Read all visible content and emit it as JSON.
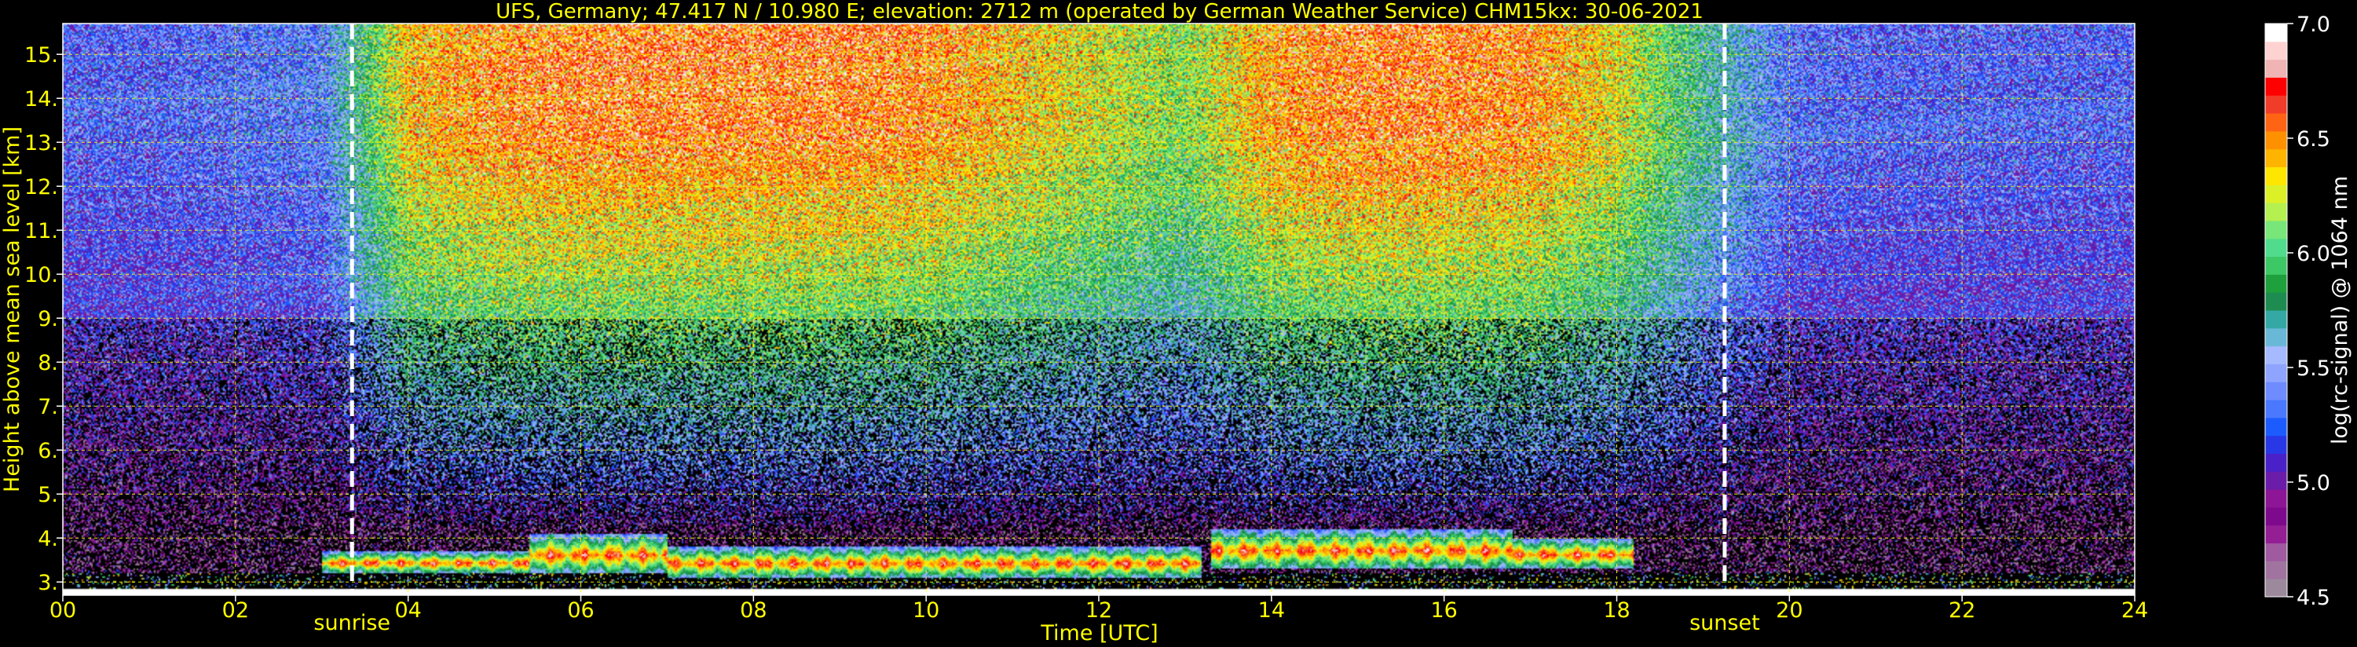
{
  "chart_data": {
    "type": "heatmap",
    "title": "UFS, Germany; 47.417 N / 10.980 E; elevation: 2712 m  (operated by German Weather Service)    CHM15kx: 30-06-2021",
    "xlabel": "Time [UTC]",
    "ylabel": "Height above mean sea level [km]",
    "xlim": [
      0,
      24
    ],
    "ylim": [
      2.7,
      15.7
    ],
    "xticks": [
      "00",
      "02",
      "04",
      "06",
      "08",
      "10",
      "12",
      "14",
      "16",
      "18",
      "20",
      "22",
      "24"
    ],
    "xtick_values": [
      0,
      2,
      4,
      6,
      8,
      10,
      12,
      14,
      16,
      18,
      20,
      22,
      24
    ],
    "yticks": [
      "3.",
      "4.",
      "5.",
      "6.",
      "7.",
      "8.",
      "9.",
      "10.",
      "11.",
      "12.",
      "13.",
      "14.",
      "15."
    ],
    "ytick_values": [
      3,
      4,
      5,
      6,
      7,
      8,
      9,
      10,
      11,
      12,
      13,
      14,
      15
    ],
    "grid": true,
    "annotations": [
      {
        "label": "sunrise",
        "x": 3.35
      },
      {
        "label": "sunset",
        "x": 19.25
      }
    ],
    "colorbar": {
      "label": "log(rc-signal) @ 1064 nm",
      "range": [
        4.5,
        7.0
      ],
      "ticks": [
        "4.5",
        "5.0",
        "5.5",
        "6.0",
        "6.5",
        "7.0"
      ],
      "tick_values": [
        4.5,
        5.0,
        5.5,
        6.0,
        6.5,
        7.0
      ],
      "colors": [
        "#9c8a9c",
        "#a0749f",
        "#a05aa0",
        "#941e94",
        "#7d0a8c",
        "#8c1696",
        "#6b1ca8",
        "#4a20c8",
        "#2838e6",
        "#1c5cff",
        "#4a78ff",
        "#6e8cff",
        "#8ea4ff",
        "#a6baff",
        "#6ab8d8",
        "#34a8a4",
        "#1e8c50",
        "#1ea03c",
        "#3cc864",
        "#50dc8c",
        "#78e678",
        "#b4f050",
        "#dcf028",
        "#ffe600",
        "#ffb400",
        "#ff9000",
        "#ff6414",
        "#f03c28",
        "#ff0000",
        "#f0b4b4",
        "#ffd2d2",
        "#ffffff"
      ]
    },
    "time_of_day_intensity": {
      "hours": [
        0,
        1,
        2,
        3,
        4,
        5,
        6,
        7,
        8,
        9,
        10,
        11,
        12,
        13,
        14,
        15,
        16,
        17,
        18,
        19,
        20,
        21,
        22,
        23,
        24
      ],
      "upper_signal": [
        5.3,
        5.3,
        5.35,
        5.4,
        6.4,
        6.55,
        6.6,
        6.6,
        6.6,
        6.6,
        6.55,
        6.4,
        6.25,
        6.1,
        6.5,
        6.6,
        6.6,
        6.55,
        6.3,
        5.8,
        5.35,
        5.3,
        5.3,
        5.3,
        5.3
      ]
    },
    "cloud_layers": [
      {
        "x_start": 3.0,
        "x_end": 5.4,
        "height_base": 3.2,
        "height_top": 3.7
      },
      {
        "x_start": 5.4,
        "x_end": 7.0,
        "height_base": 3.2,
        "height_top": 4.1
      },
      {
        "x_start": 7.0,
        "x_end": 13.2,
        "height_base": 3.1,
        "height_top": 3.8
      },
      {
        "x_start": 13.3,
        "x_end": 16.8,
        "height_base": 3.3,
        "height_top": 4.2
      },
      {
        "x_start": 16.8,
        "x_end": 18.2,
        "height_base": 3.3,
        "height_top": 4.0
      }
    ]
  }
}
